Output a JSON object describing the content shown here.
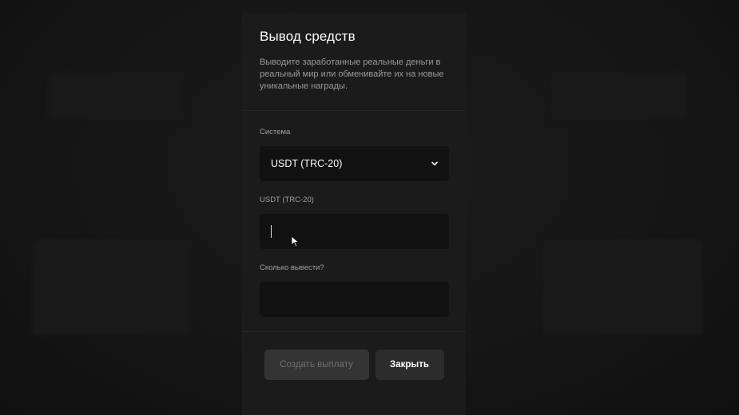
{
  "modal": {
    "title": "Вывод средств",
    "description": "Выводите заработанные реальные деньги в реальный мир или обменивайте их на новые уникальные награды."
  },
  "fields": {
    "system": {
      "label": "Система",
      "value": "USDT (TRC-20)"
    },
    "address": {
      "label": "USDT (TRC-20)",
      "value": "",
      "placeholder": ""
    },
    "amount": {
      "label": "Сколько вывести?",
      "value": "",
      "placeholder": ""
    }
  },
  "buttons": {
    "create": "Создать выплату",
    "close": "Закрыть"
  },
  "icons": {
    "select": "chevron-down-icon",
    "pointer": "mouse-cursor-icon"
  },
  "colors": {
    "modal_bg": "#1b1b1b",
    "input_bg": "#111111",
    "disabled_button": "#343434",
    "primary_text": "#ffffff"
  }
}
